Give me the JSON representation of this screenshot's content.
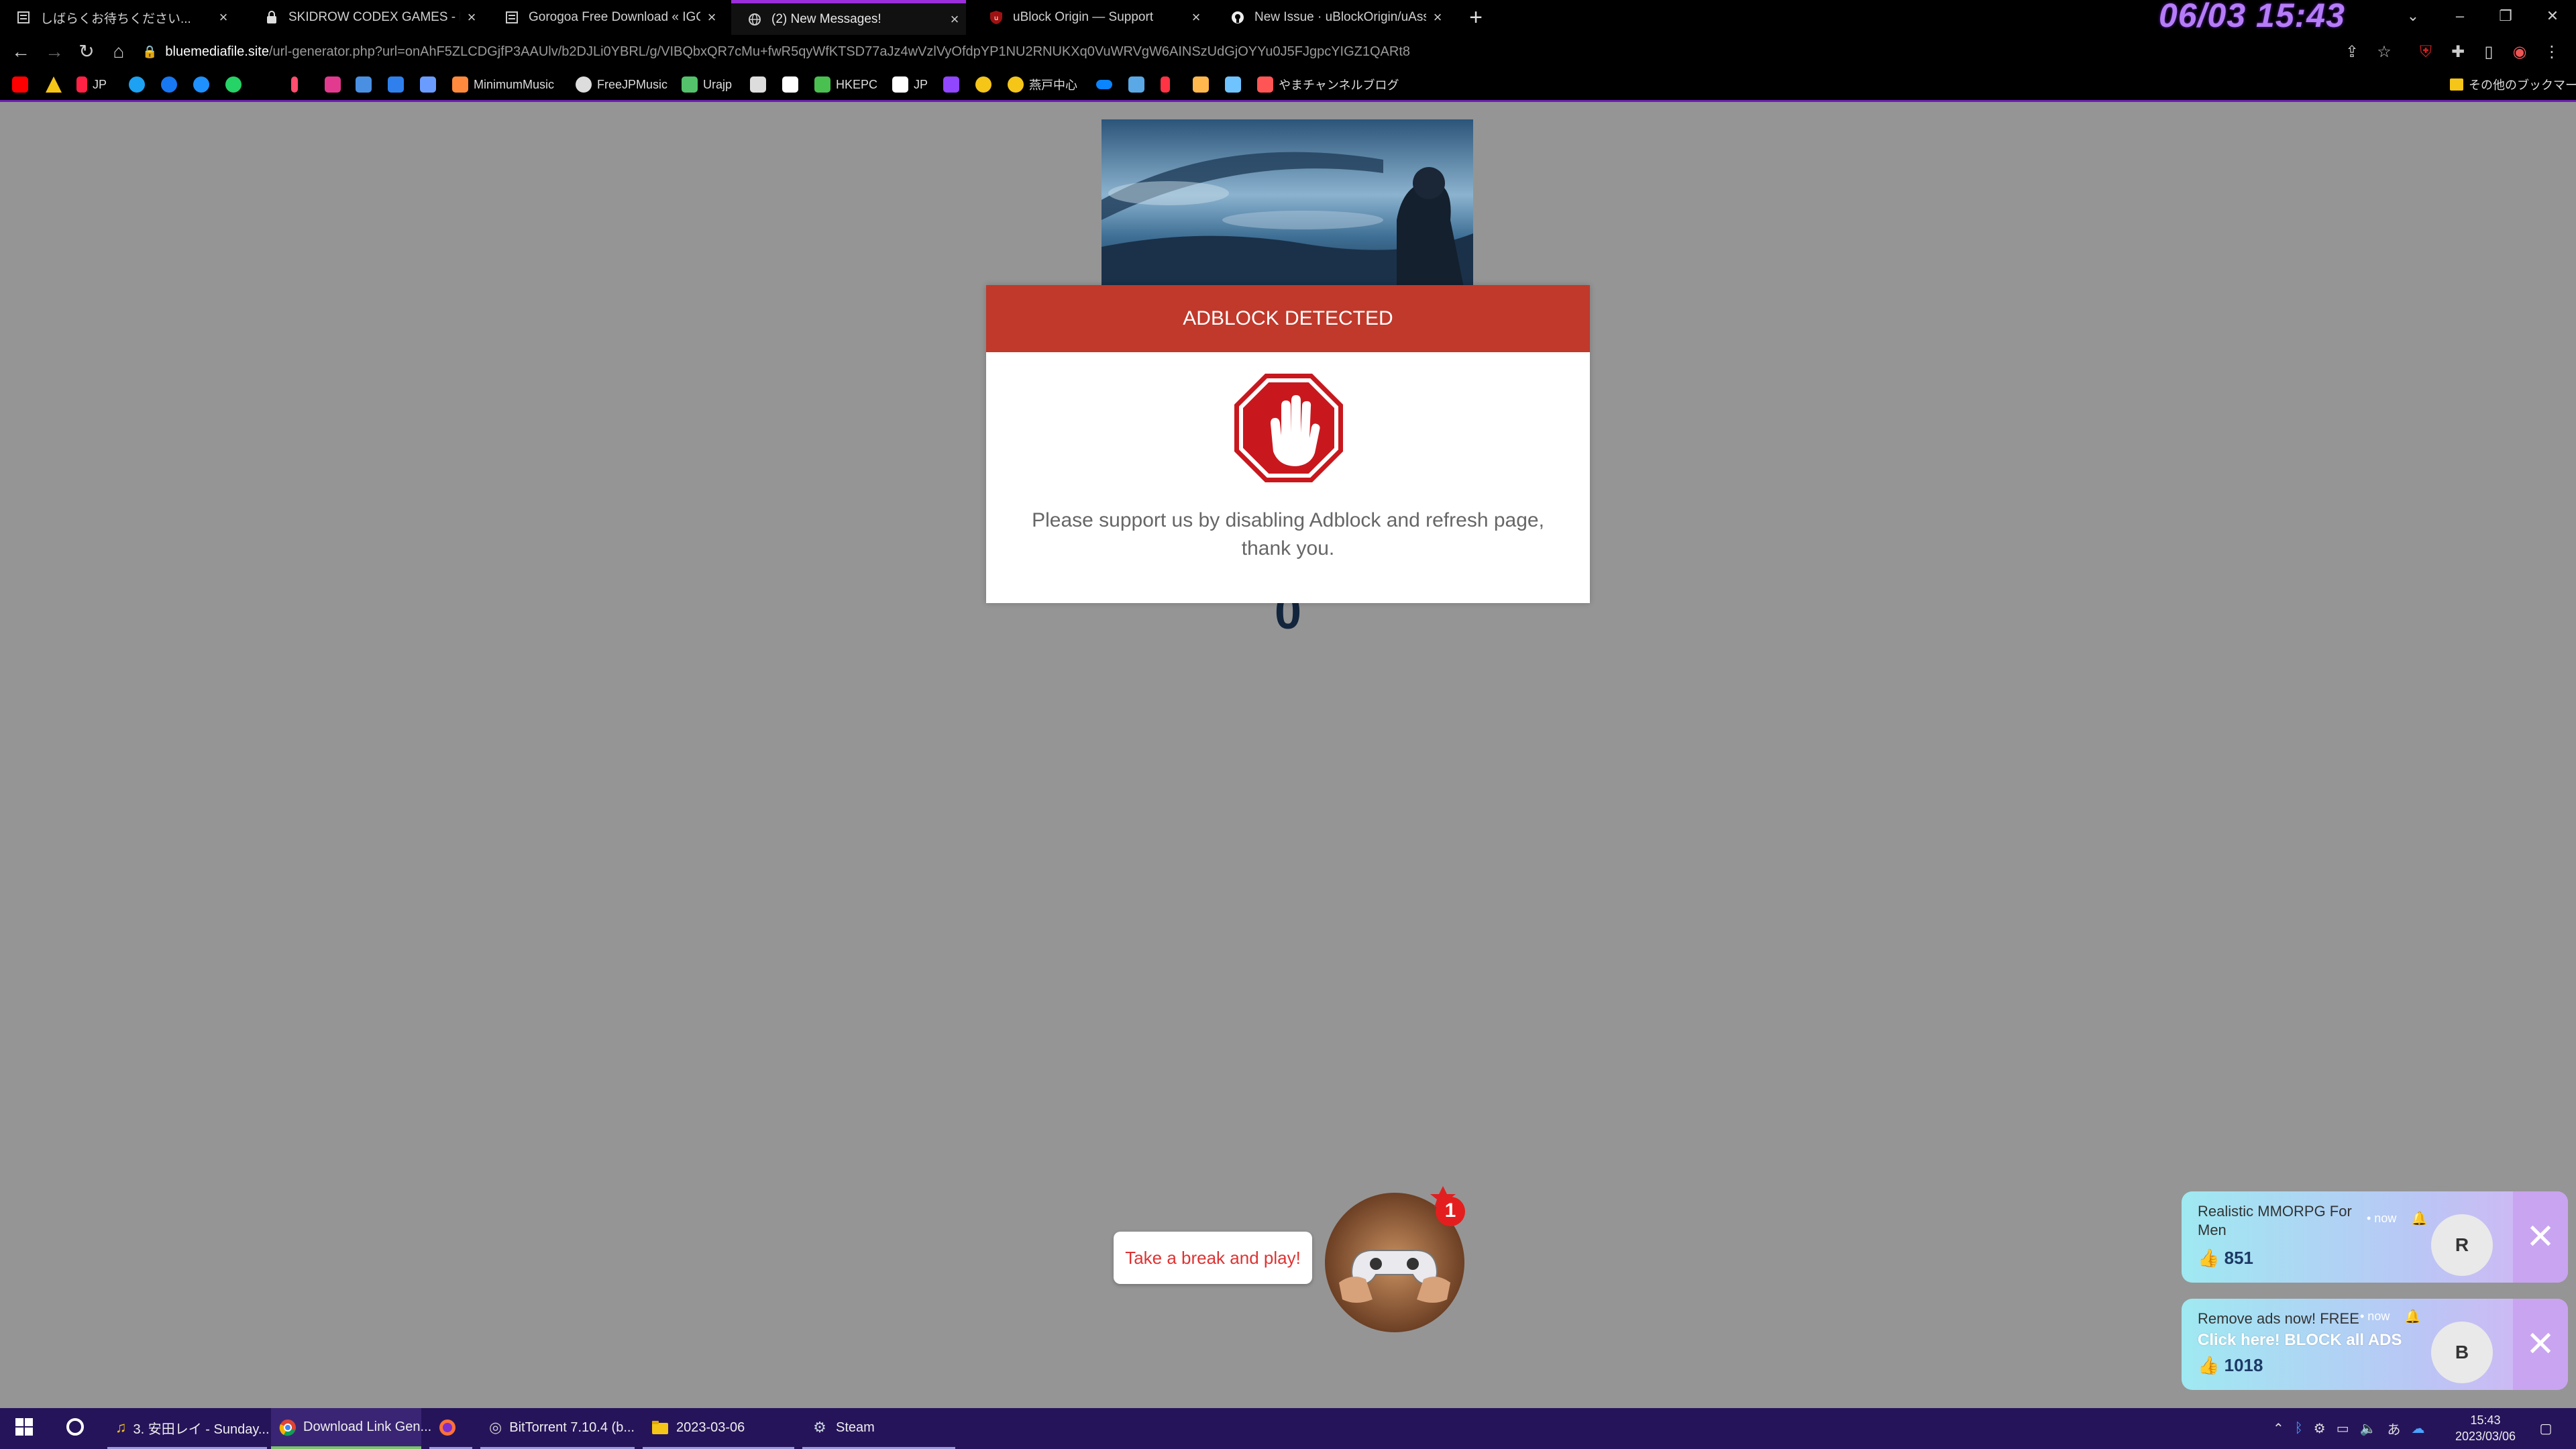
{
  "tabs": [
    {
      "title": "しばらくお待ちください...",
      "favicon": "page-icon"
    },
    {
      "title": "SKIDROW CODEX GAMES - Dow",
      "favicon": "lock-icon"
    },
    {
      "title": "Gorogoa Free Download « IGGG",
      "favicon": "page-icon"
    },
    {
      "title": "(2) New Messages!",
      "favicon": "globe-icon"
    },
    {
      "title": "uBlock Origin — Support",
      "favicon": "ublock-icon"
    },
    {
      "title": "New Issue · uBlockOrigin/uAssets",
      "favicon": "github-icon"
    }
  ],
  "active_tab_index": 3,
  "overlay_clock": "06/03 15:43",
  "address": {
    "host": "bluemediafile.site",
    "path": "/url-generator.php?url=onAhF5ZLCDGjfP3AAUlv/b2DJLi0YBRL/g/VIBQbxQR7cMu+fwR5qyWfKTSD77aJz4wVzlVyOfdpYP1NU2RNUKXq0VuWRVgW6AINSzUdGjOYYu0J5FJgpcYIGZ1QARt8"
  },
  "bookmarks": {
    "items": [
      {
        "label": "",
        "color": "#ff0000"
      },
      {
        "label": "",
        "color": "#f5c518"
      },
      {
        "label": "JP",
        "color": "#ff2244"
      },
      {
        "label": "",
        "color": "#1da1f2"
      },
      {
        "label": "",
        "color": "#1877f2"
      },
      {
        "label": "",
        "color": "#1e90ff"
      },
      {
        "label": "",
        "color": "#25d366"
      },
      {
        "label": "",
        "color": "#ff4d6d"
      },
      {
        "label": "",
        "color": "#e23a8e"
      },
      {
        "label": "",
        "color": "#4a90e2"
      },
      {
        "label": "",
        "color": "#2f80ed"
      },
      {
        "label": "",
        "color": "#6a9cff"
      },
      {
        "label": "MinimumMusic",
        "color": "#ff8a3d"
      },
      {
        "label": "FreeJPMusic",
        "color": "#dddddd"
      },
      {
        "label": "Urajp",
        "color": "#53c26b"
      },
      {
        "label": "",
        "color": "#dddddd"
      },
      {
        "label": "",
        "color": "#ffffff"
      },
      {
        "label": "HKEPC",
        "color": "#49c04f"
      },
      {
        "label": "JP",
        "color": "#ffffff"
      },
      {
        "label": "",
        "color": "#9146ff"
      },
      {
        "label": "",
        "color": "#f5c518"
      },
      {
        "label": "燕戸中心",
        "color": "#f5c518"
      },
      {
        "label": "",
        "color": "#0a84ff"
      },
      {
        "label": "",
        "color": "#5aa9e6"
      },
      {
        "label": "",
        "color": "#ff3344"
      },
      {
        "label": "",
        "color": "#ffb84d"
      },
      {
        "label": "",
        "color": "#6fc3ff"
      },
      {
        "label": "",
        "color": "#c7d5e0"
      },
      {
        "label": "やまチャンネルブログ",
        "color": "#ff5555"
      }
    ],
    "other": "その他のブックマーク"
  },
  "modal": {
    "title": "ADBLOCK DETECTED",
    "message": "Please support us by disabling Adblock and refresh page, thank you.",
    "header_color": "#c0392b"
  },
  "countdown": "0",
  "game_widget": {
    "bubble": "Take a break and play!",
    "badge": "1"
  },
  "notifications": [
    {
      "title": "Realistic MMORPG For Men",
      "subtitle": "",
      "time": "• now",
      "count": "851",
      "avatar": "R"
    },
    {
      "title": "Remove ads now! FREE",
      "subtitle": "Click here! BLOCK all ADS",
      "time": "• now",
      "count": "1018",
      "avatar": "B"
    }
  ],
  "taskbar": {
    "items": [
      {
        "label": "3. 安田レイ - Sunday...",
        "icon": "music-icon"
      },
      {
        "label": "Download Link Gen...",
        "icon": "chrome-icon"
      },
      {
        "label": "",
        "icon": "firefox-icon"
      },
      {
        "label": "BitTorrent 7.10.4 (b...",
        "icon": "bittorrent-icon"
      },
      {
        "label": "2023-03-06",
        "icon": "folder-icon"
      },
      {
        "label": "Steam",
        "icon": "steam-icon"
      }
    ],
    "time": "15:43",
    "date": "2023/03/06",
    "ime": "あ"
  }
}
